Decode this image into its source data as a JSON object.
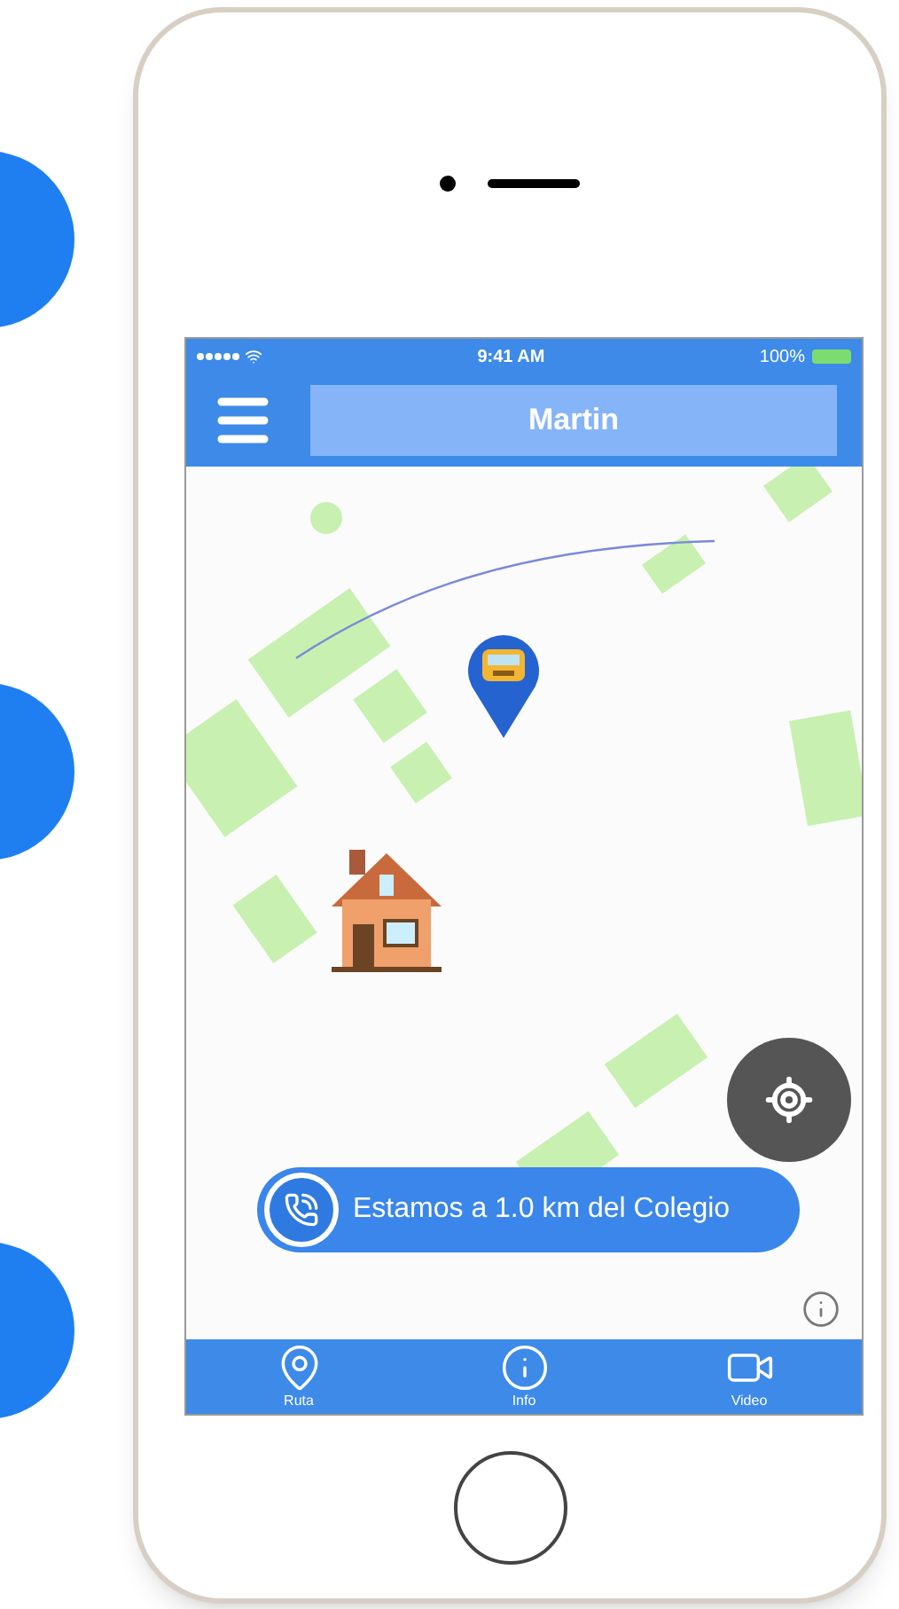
{
  "status_bar": {
    "time": "9:41 AM",
    "battery": "100%"
  },
  "header": {
    "title": "Martin"
  },
  "banner": {
    "text": "Estamos a 1.0 km del Colegio"
  },
  "tabs": [
    {
      "kind": "route",
      "label": "Ruta"
    },
    {
      "kind": "info",
      "label": "Info"
    },
    {
      "kind": "video",
      "label": "Video"
    }
  ]
}
